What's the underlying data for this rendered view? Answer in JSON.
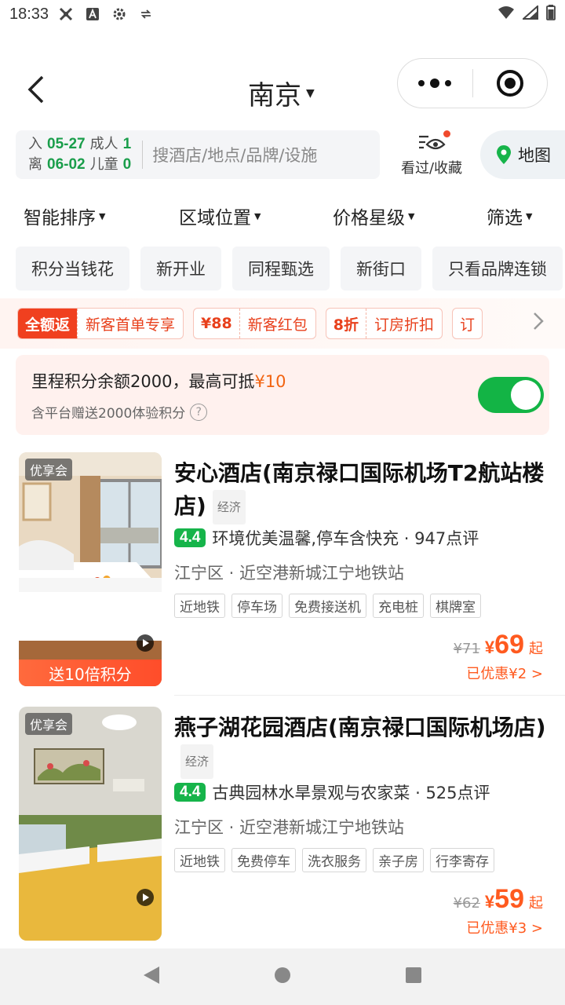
{
  "status_bar": {
    "time": "18:33"
  },
  "header": {
    "city": "南京"
  },
  "search": {
    "checkin_label": "入",
    "checkin_date": "05-27",
    "checkout_label": "离",
    "checkout_date": "06-02",
    "adults_label": "成人",
    "adults": "1",
    "children_label": "儿童",
    "children": "0",
    "placeholder": "搜酒店/地点/品牌/设施",
    "viewed_label": "看过/收藏",
    "map_label": "地图"
  },
  "sort": [
    "智能排序",
    "区域位置",
    "价格星级",
    "筛选"
  ],
  "chips": [
    "积分当钱花",
    "新开业",
    "同程甄选",
    "新街口",
    "只看品牌连锁"
  ],
  "promos": [
    {
      "left": "全额返",
      "right": "新客首单专享"
    },
    {
      "left": "¥88",
      "right": "新客红包"
    },
    {
      "left": "8折",
      "right": "订房折扣"
    },
    {
      "left": "订",
      "right": ""
    }
  ],
  "mileage": {
    "text": "里程积分余额2000，最高可抵",
    "amount": "¥10",
    "sub": "含平台赠送2000体验积分",
    "help": "?",
    "enabled": true
  },
  "hotels": [
    {
      "badge": "优享会",
      "bonus": "送10倍积分",
      "name": "安心酒店(南京禄口国际机场T2航站楼店)",
      "class": "经济",
      "score": "4.4",
      "summary": "环境优美温馨,停车含快充 · 947点评",
      "location": "江宁区 · 近空港新城江宁地铁站",
      "tags": [
        "近地铁",
        "停车场",
        "免费接送机",
        "充电桩",
        "棋牌室"
      ],
      "orig_price": "¥71",
      "price_symbol": "¥",
      "price": "69",
      "price_suffix": "起",
      "saved": "已优惠¥2 >"
    },
    {
      "badge": "优享会",
      "bonus": "",
      "name": "燕子湖花园酒店(南京禄口国际机场店)",
      "class": "经济",
      "score": "4.4",
      "summary": "古典园林水旱景观与农家菜 · 525点评",
      "location": "江宁区 · 近空港新城江宁地铁站",
      "tags": [
        "近地铁",
        "免费停车",
        "洗衣服务",
        "亲子房",
        "行李寄存"
      ],
      "orig_price": "¥62",
      "price_symbol": "¥",
      "price": "59",
      "price_suffix": "起",
      "saved": "已优惠¥3 >"
    }
  ],
  "colors": {
    "green": "#16b44a",
    "orange": "#ff5a1f",
    "promo_red": "#f0401f"
  }
}
